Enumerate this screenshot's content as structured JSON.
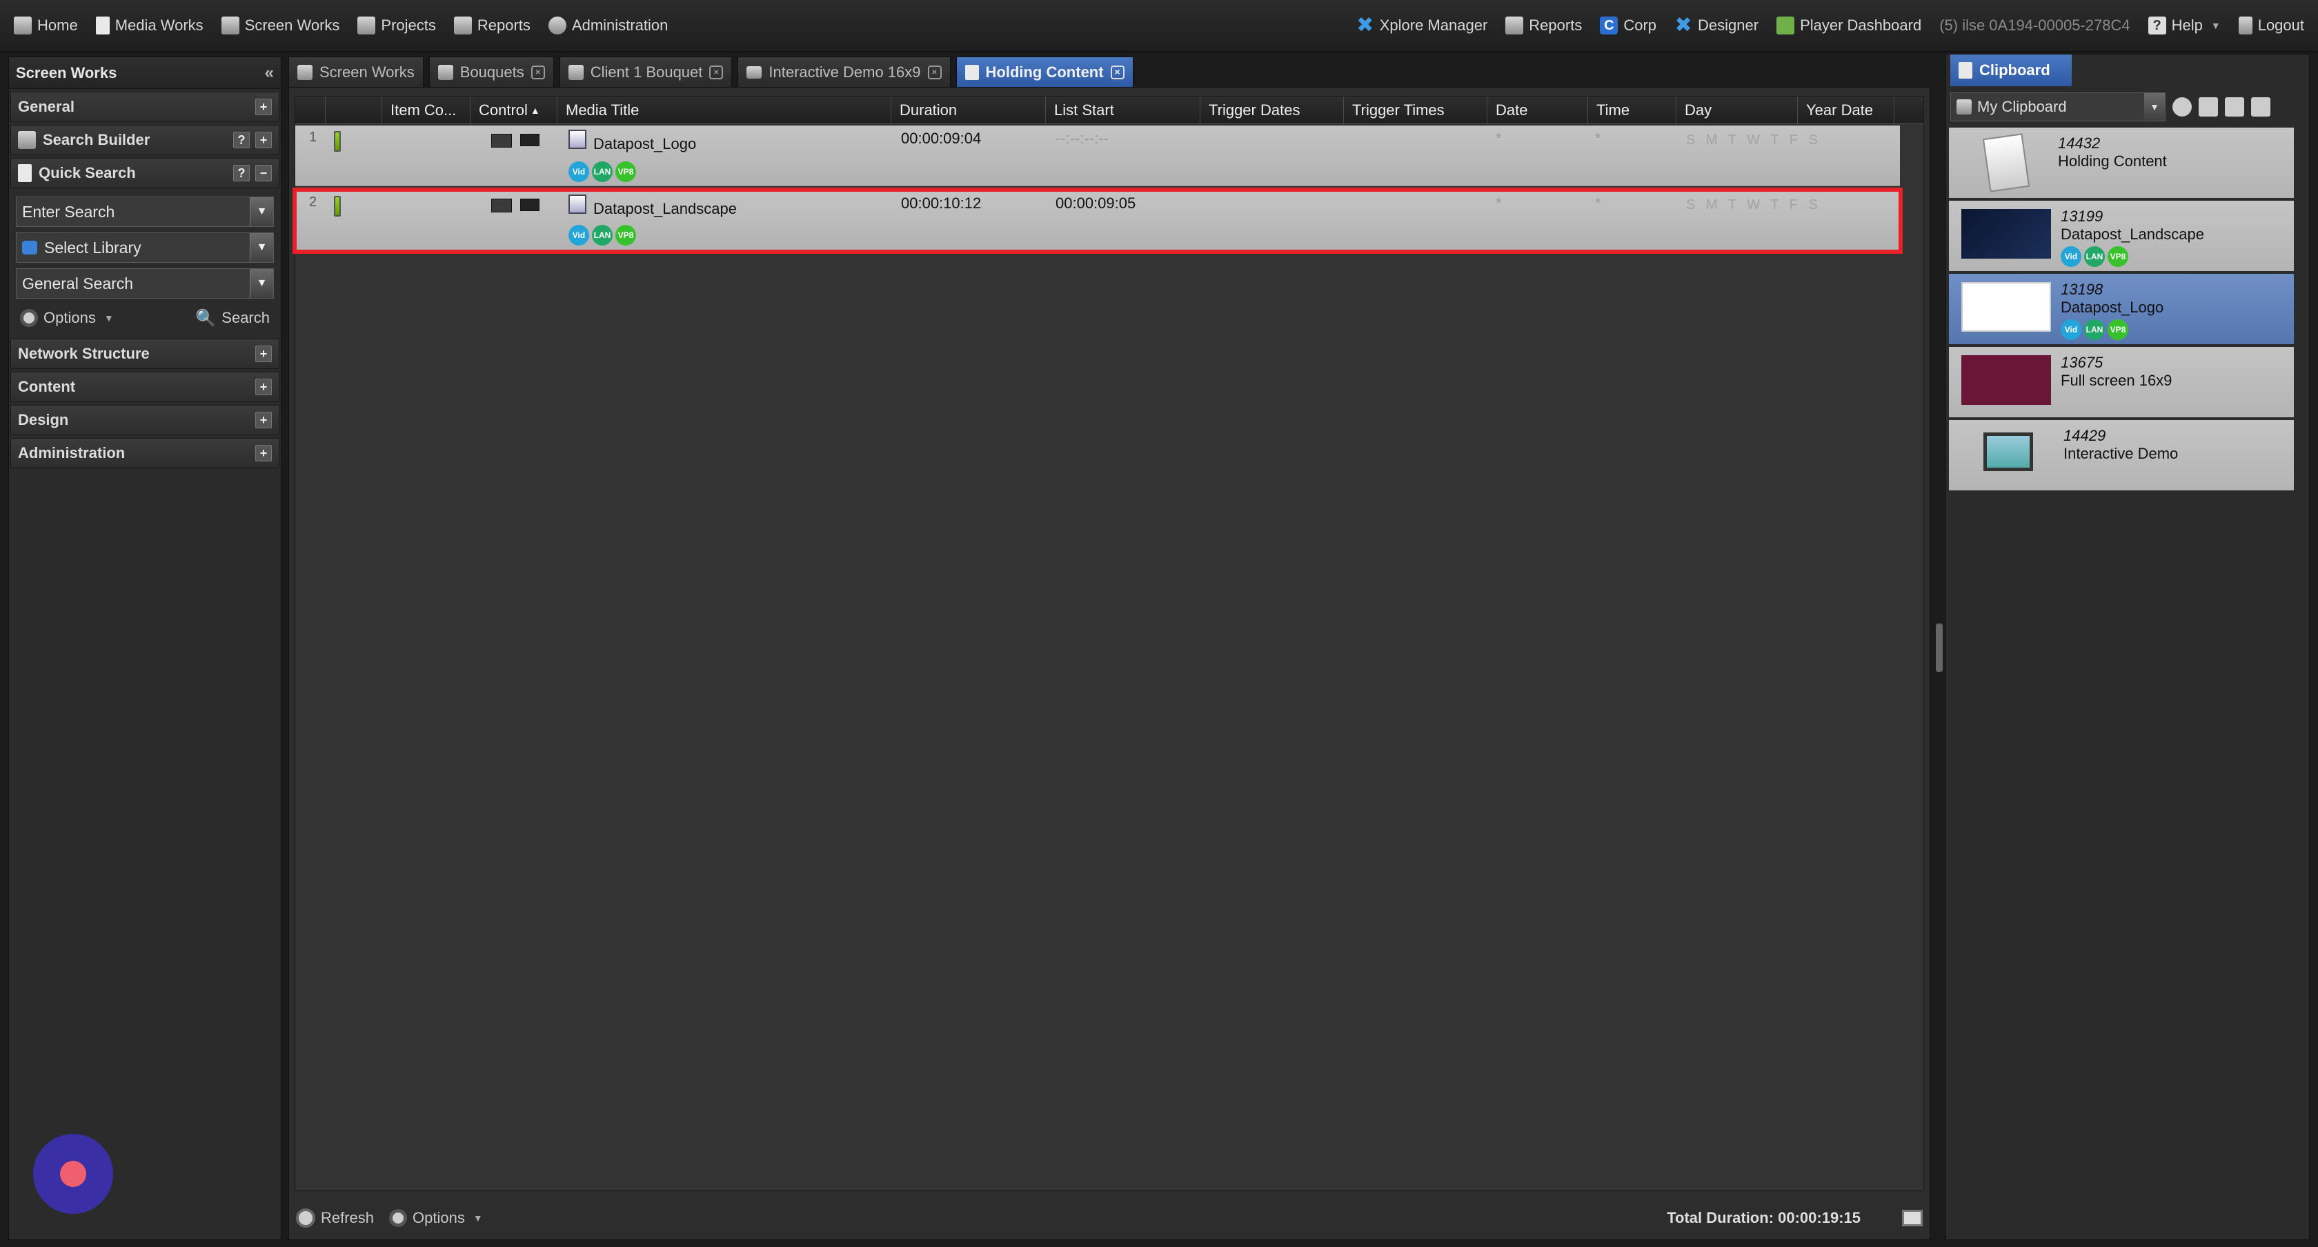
{
  "topnav": {
    "left": [
      {
        "label": "Home",
        "icon": "home-icon"
      },
      {
        "label": "Media Works",
        "icon": "media-works-icon"
      },
      {
        "label": "Screen Works",
        "icon": "screen-works-icon"
      },
      {
        "label": "Projects",
        "icon": "projects-icon"
      },
      {
        "label": "Reports",
        "icon": "reports-icon"
      },
      {
        "label": "Administration",
        "icon": "administration-icon"
      }
    ],
    "right": [
      {
        "label": "Xplore Manager",
        "icon": "xplore-icon"
      },
      {
        "label": "Reports",
        "icon": "reports-icon"
      },
      {
        "label": "Corp",
        "icon": "corp-icon"
      },
      {
        "label": "Designer",
        "icon": "designer-icon"
      },
      {
        "label": "Player Dashboard",
        "icon": "player-dashboard-icon"
      }
    ],
    "session": "(5) ilse 0A194-00005-278C4",
    "help": "Help",
    "logout": "Logout"
  },
  "left_panel": {
    "title": "Screen Works",
    "sections_top": [
      "General"
    ],
    "search_builder": "Search Builder",
    "quick_search": "Quick Search",
    "enter_search": "Enter Search",
    "select_library": "Select Library",
    "general_search": "General Search",
    "options": "Options",
    "search": "Search",
    "sections_bottom": [
      "Network Structure",
      "Content",
      "Design",
      "Administration"
    ]
  },
  "tabs": [
    {
      "label": "Screen Works",
      "closable": false
    },
    {
      "label": "Bouquets",
      "closable": true
    },
    {
      "label": "Client 1 Bouquet",
      "closable": true
    },
    {
      "label": "Interactive Demo 16x9",
      "closable": true
    },
    {
      "label": "Holding Content",
      "closable": true,
      "active": true
    }
  ],
  "grid": {
    "columns": [
      "",
      "",
      "Item Co...",
      "Control",
      "Media Title",
      "Duration",
      "List Start",
      "Trigger Dates",
      "Trigger Times",
      "Date",
      "Time",
      "Day",
      "Year Date"
    ],
    "rows": [
      {
        "num": "1",
        "title": "Datapost_Logo",
        "duration": "00:00:09:04",
        "list_start": "--:--:--:--",
        "date": "*",
        "time": "*",
        "day": "S M T W T F S",
        "badges": [
          "Vid",
          "LAN",
          "VP8"
        ]
      },
      {
        "num": "2",
        "title": "Datapost_Landscape",
        "duration": "00:00:10:12",
        "list_start": "00:00:09:05",
        "date": "*",
        "time": "*",
        "day": "S M T W T F S",
        "badges": [
          "Vid",
          "LAN",
          "VP8"
        ]
      }
    ]
  },
  "footer": {
    "refresh": "Refresh",
    "options": "Options",
    "total": "Total Duration: 00:00:19:15"
  },
  "clipboard": {
    "tab": "Clipboard",
    "selector": "My Clipboard",
    "items": [
      {
        "id": "14432",
        "name": "Holding Content",
        "thumb": "document"
      },
      {
        "id": "13199",
        "name": "Datapost_Landscape",
        "thumb": "dark",
        "badges": [
          "Vid",
          "LAN",
          "VP8"
        ]
      },
      {
        "id": "13198",
        "name": "Datapost_Logo",
        "thumb": "logo",
        "badges": [
          "Vid",
          "LAN",
          "VP8"
        ],
        "selected": true
      },
      {
        "id": "13675",
        "name": "Full screen 16x9",
        "thumb": "wine"
      },
      {
        "id": "14429",
        "name": "Interactive Demo",
        "thumb": "monitor"
      }
    ]
  },
  "colors": {
    "accent": "#2e5aa5",
    "selection_outline": "#e8202a",
    "badge_vid": "#23a5d9",
    "badge_lan": "#21a867",
    "badge_vp8": "#37c22c"
  }
}
